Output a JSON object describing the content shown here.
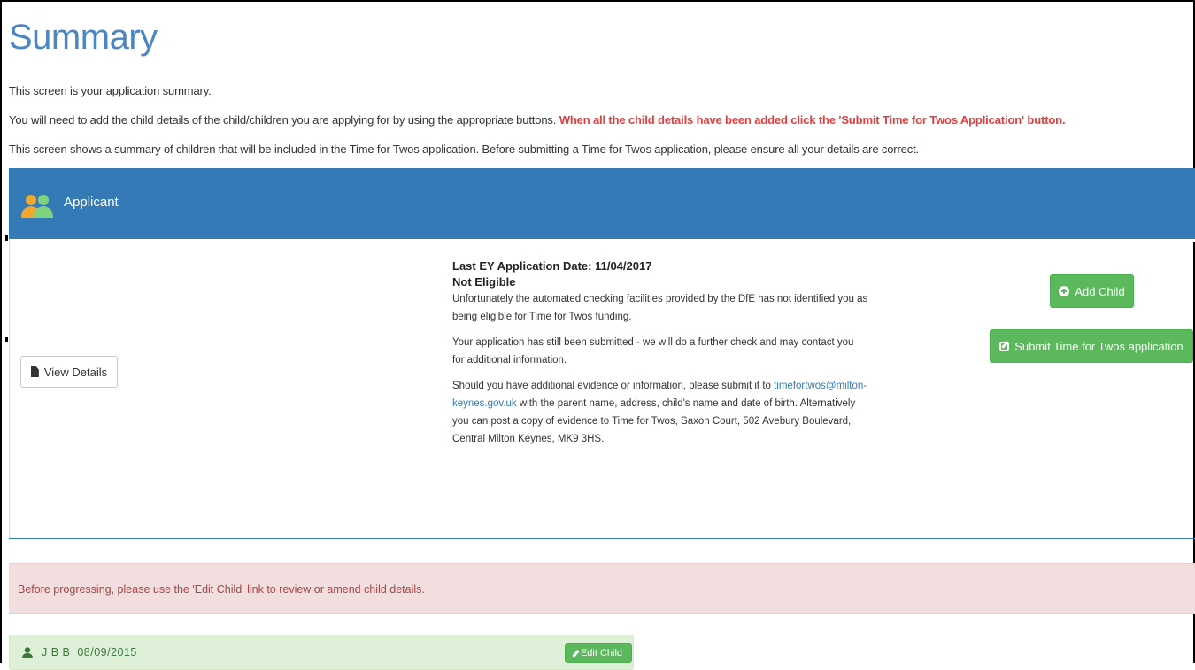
{
  "page": {
    "title": "Summary",
    "intro1": "This screen is your application summary.",
    "intro2_start": "You will need to add the child details of the child/children you are applying for by using the appropriate buttons. ",
    "intro2_warning": "When all the child details have been added click the 'Submit Time for Twos Application' button.",
    "intro3": "This screen shows a summary of children that will be included in the Time for Twos application. Before submitting a Time for Twos application, please ensure all your details are correct."
  },
  "applicant": {
    "heading": "Applicant",
    "view_details_label": "View Details",
    "last_application": "Last EY Application Date: 11/04/2017",
    "eligibility": "Not Eligible",
    "para1": "Unfortunately the automated checking facilities provided by the DfE has not identified you as being eligible for Time for Twos funding.",
    "para2": "Your application has still been submitted - we will do a further check and may contact you for additional information.",
    "para3_start": "Should you have additional evidence or information, please submit it to ",
    "para3_email": "timefortwos@milton-keynes.gov.uk",
    "para3_end": " with the parent name, address, child's name and date of birth. Alternatively you can post a copy of evidence to Time for Twos, Saxon Court, 502 Avebury Boulevard, Central Milton Keynes, MK9 3HS.",
    "add_child_label": "Add Child",
    "submit_label": "Submit Time for Twos application"
  },
  "alert": {
    "text": "Before progressing, please use the 'Edit Child' link to review or amend child details."
  },
  "children": [
    {
      "name": "J B B",
      "dob": "08/09/2015",
      "edit_label": "Edit Child"
    }
  ],
  "colors": {
    "primary": "#337ab7",
    "title": "#4b86c2",
    "success": "#5cb85c",
    "warning_text": "#ea3b3b",
    "alert_bg": "#f2dede",
    "alert_text": "#a94442",
    "child_bg": "#dff0d8"
  },
  "icons": {
    "applicant": "people-icon",
    "view": "document-icon",
    "add": "plus-circle-icon",
    "submit": "edit-square-icon",
    "child": "person-icon",
    "edit": "pencil-icon"
  }
}
